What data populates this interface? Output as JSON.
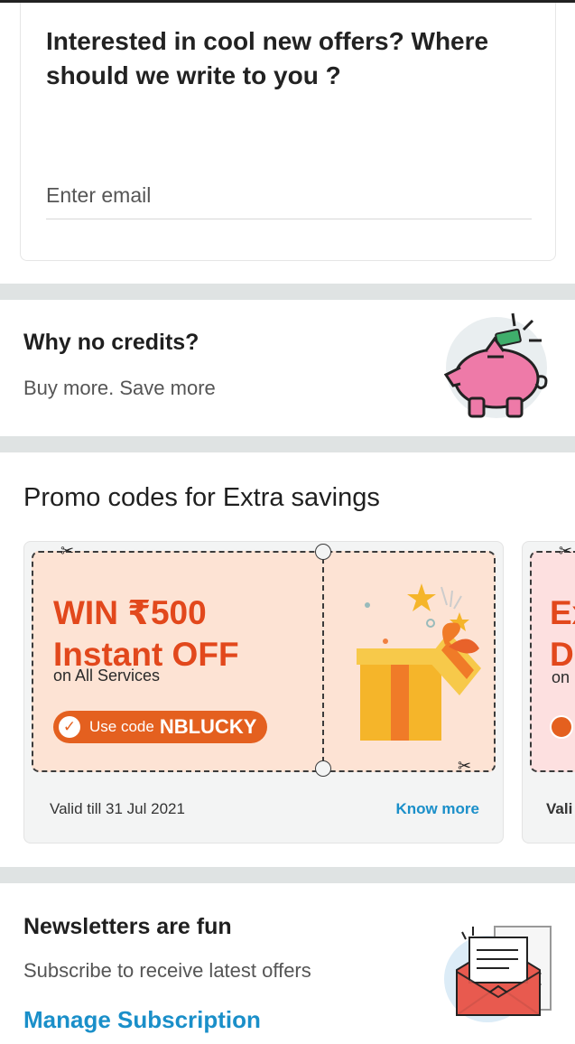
{
  "email_section": {
    "title": "Interested in cool new offers? Where should we write to you ?",
    "email_placeholder": "Enter email"
  },
  "credits_section": {
    "title": "Why no credits?",
    "subtitle": "Buy more. Save more",
    "icon": "piggy-bank-icon"
  },
  "promo_section": {
    "title": "Promo codes for Extra savings",
    "cards": [
      {
        "headline": "WIN ₹500 Instant OFF",
        "subtitle": "on All Services",
        "code_prefix": "Use code",
        "code": "NBLUCKY",
        "validity": "Valid till 31 Jul 2021",
        "link": "Know more",
        "icon": "gift-box-icon"
      },
      {
        "headline_partial": "Ex Di",
        "subtitle_partial": "on",
        "validity_partial": "Vali"
      }
    ]
  },
  "newsletter_section": {
    "title": "Newsletters are fun",
    "subtitle": "Subscribe to receive latest offers",
    "link": "Manage Subscription",
    "icon": "envelope-letter-icon"
  },
  "colors": {
    "accent_orange": "#e2481c",
    "link_blue": "#1a8fc9",
    "divider_gray": "#dfe3e3",
    "coupon_bg": "#fde3d4"
  }
}
